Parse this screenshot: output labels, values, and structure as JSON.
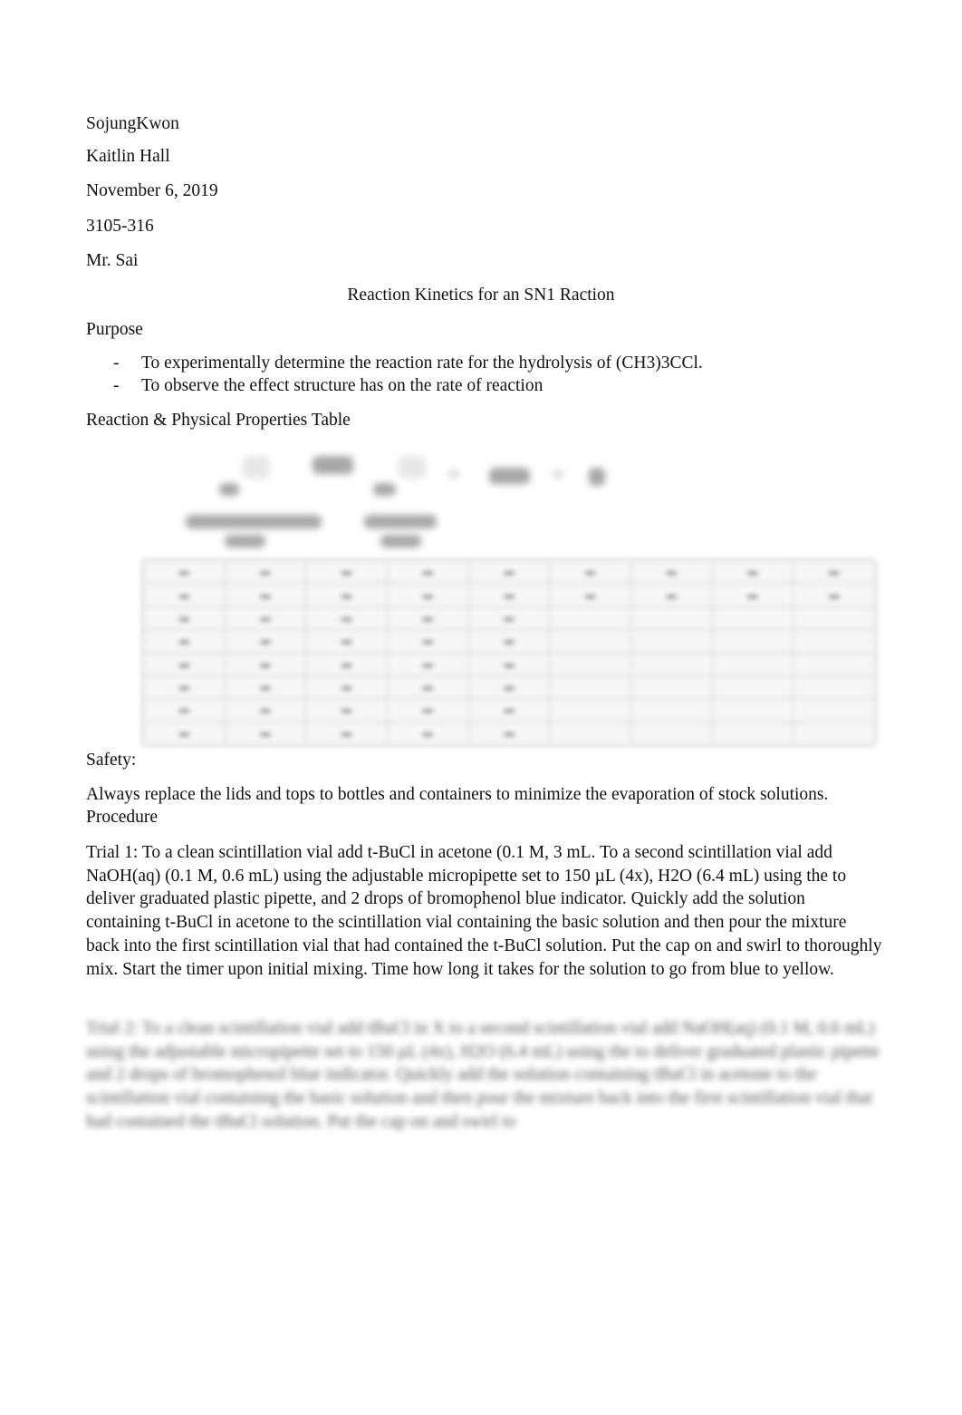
{
  "header": {
    "author": "SojungKwon",
    "partner": "Kaitlin Hall",
    "date": "November 6, 2019",
    "section": "3105-316",
    "instructor": "Mr. Sai"
  },
  "title": "Reaction Kinetics for an SN1 Raction",
  "purpose": {
    "heading": "Purpose",
    "bullet_marker": "-",
    "items": [
      "To experimentally determine the reaction rate for the hydrolysis of (CH3)3CCl.",
      "To observe the effect structure has on the rate of reaction"
    ]
  },
  "properties": {
    "heading": "Reaction & Physical Properties Table",
    "scheme_obscured": true,
    "table_obscured": true,
    "table_columns": 9,
    "table_rows": 8
  },
  "safety": {
    "heading": "Safety:",
    "text": "Always replace the lids and tops to bottles and containers to minimize the evaporation of stock solutions."
  },
  "procedure": {
    "heading": "Procedure",
    "trial1": "Trial 1: To a clean scintillation vial add t-BuCl in acetone (0.1 M, 3 mL.  To a second scintillation vial add NaOH(aq) (0.1 M, 0.6 mL) using the adjustable micropipette set to 150 µL (4x), H2O (6.4 mL) using the to deliver graduated plastic pipette, and 2 drops of bromophenol blue indicator.  Quickly add the solution containing t-BuCl in acetone to the scintillation vial containing the basic solution and then pour the mixture back into the first scintillation vial that had contained the t-BuCl solution.  Put the cap on and swirl to thoroughly mix.  Start the timer upon initial mixing.  Time how long it takes for the solution to go from blue to yellow.",
    "trial2_obscured": "Trial 2: To a clean scintillation vial add tBuCl in X to a second scintillation vial add NaOH(aq) (0.1 M, 0.6 mL) using the adjustable micropipette set to 150 µL (4x), H2O (6.4 mL) using the to deliver graduated plastic pipette and 2 drops of bromophenol blue indicator.  Quickly add the solution containing tBuCl in acetone to the scintillation vial containing the basic solution and then pour the mixture back into the first scintillation vial that had contained the tBuCl solution.  Put the cap on and swirl to"
  }
}
